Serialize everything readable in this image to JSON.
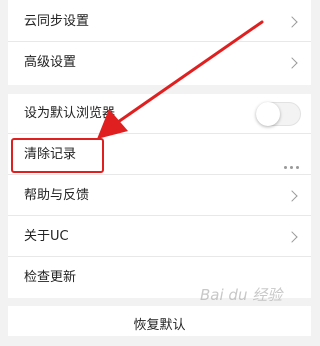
{
  "settings_top": {
    "cloud_sync": "云同步设置",
    "advanced": "高级设置"
  },
  "settings_mid": {
    "default_browser": "设为默认浏览器",
    "default_browser_enabled": false,
    "clear_records": "清除记录",
    "help_feedback": "帮助与反馈",
    "about": "关于UC",
    "check_update": "检查更新"
  },
  "restore_default": "恢复默认",
  "watermark": "Bai du 经验",
  "annotation_color": "#e02020"
}
